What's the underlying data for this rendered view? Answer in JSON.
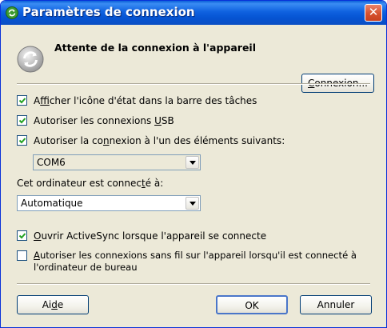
{
  "window": {
    "title": "Paramètres de connexion",
    "close_label": "✕"
  },
  "status": {
    "text": "Attente de la connexion à l'appareil"
  },
  "buttons": {
    "connect_pre": "",
    "connect_u": "C",
    "connect_post": "onnexion...",
    "help_pre": "Ai",
    "help_u": "d",
    "help_post": "e",
    "ok": "OK",
    "cancel": "Annuler"
  },
  "checkboxes": [
    {
      "pre": "A",
      "u": "f",
      "post": "ficher l'icône d'état dans la barre des tâches",
      "checked": true
    },
    {
      "pre": "Autoriser les connexions ",
      "u": "U",
      "post": "SB",
      "checked": true
    },
    {
      "pre": "Autoriser la co",
      "u": "n",
      "post": "nexion à l'un des éléments suivants:",
      "checked": true
    },
    {
      "pre": "",
      "u": "O",
      "post": "uvrir ActiveSync lorsque l'appareil se connecte",
      "checked": true
    },
    {
      "pre": "",
      "u": "A",
      "post": "utoriser les connexions sans fil sur l'appareil lorsqu'il est connecté à",
      "line2": "l'ordinateur de bureau",
      "checked": false
    }
  ],
  "port_select": {
    "value": "COM6"
  },
  "connected_to": {
    "label_pre": "Cet ordinateur est connec",
    "label_u": "t",
    "label_post": "é à:",
    "value": "Automatique"
  }
}
